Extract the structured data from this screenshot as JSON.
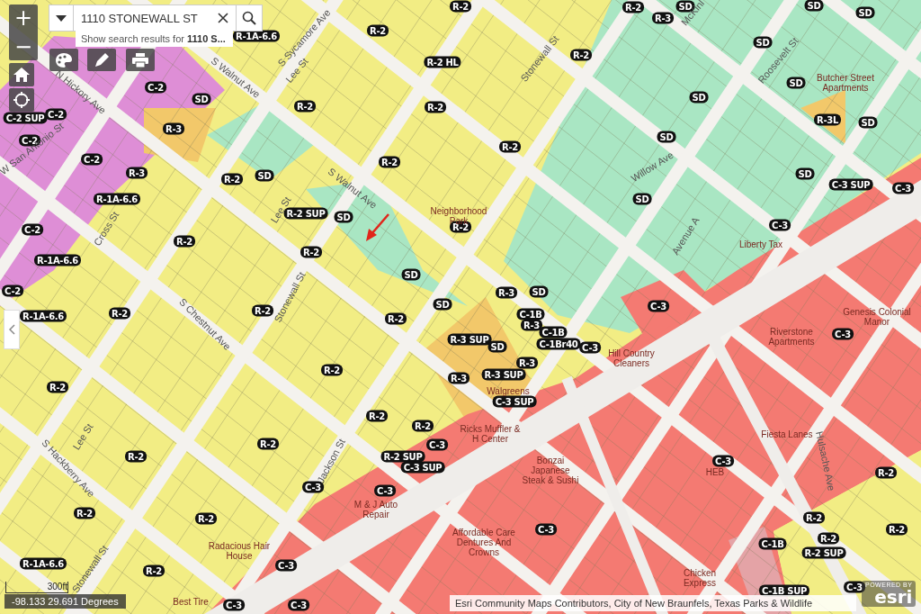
{
  "map_controls": {
    "zoom_in": "+",
    "zoom_out": "−"
  },
  "search": {
    "value": "1110 STONEWALL ST",
    "suggestion": "Show search results for **1110 S...**"
  },
  "zone_labels": [
    "R-1A-6.6",
    "R-2",
    "R-2",
    "R-3",
    "SD",
    "SD",
    "SD",
    "R-2",
    "R-2 HL",
    "R-2",
    "SD",
    "SD",
    "SD",
    "C-2",
    "C-2",
    "SD",
    "C-2 SUP",
    "R-2",
    "R-2",
    "R-3",
    "C-2",
    "R-3L",
    "SD",
    "C-2",
    "R-3",
    "R-2",
    "R-2",
    "SD",
    "R-2",
    "SD",
    "SD",
    "C-3 SUP",
    "C-3",
    "R-1A-6.6",
    "R-2 SUP",
    "SD",
    "R-2",
    "SD",
    "C-3",
    "C-2",
    "R-2",
    "R-2",
    "R-1A-6.6",
    "SD",
    "C-2",
    "R-3",
    "SD",
    "SD",
    "C-3",
    "R-2",
    "R-2",
    "R-2",
    "R-1A-6.6",
    "C-1B",
    "R-3",
    "C-1B",
    "C-1Br40",
    "C-3",
    "C-3",
    "R-3 SUP",
    "SD",
    "R-3",
    "R-3 SUP",
    "R-2",
    "R-3",
    "C-3 SUP",
    "R-2",
    "R-2",
    "R-2",
    "C-3",
    "R-2",
    "R-2",
    "R-2 SUP",
    "C-3 SUP",
    "C-3",
    "R-2",
    "C-3",
    "C-3",
    "R-2",
    "R-2",
    "R-2",
    "R-2",
    "C-3",
    "C-3",
    "R-1A-6.6",
    "R-2",
    "C-1B",
    "R-2",
    "R-2 SUP",
    "C-1B SUP",
    "C-3",
    "C-3",
    "C-3"
  ],
  "street_labels": [
    "S Walnut Ave",
    "S Sycamore Ave",
    "Lee St",
    "Stonewall St",
    "McKinl",
    "Roosevelt St",
    "N Hickory Ave",
    "W San Antonio St",
    "S Walnut Ave",
    "Willow Ave",
    "Lee St",
    "Avenue A",
    "Cross St",
    "Stonewall St",
    "S Chestnut Ave",
    "Lee St",
    "S Hackberry Ave",
    "Jackson St",
    "Hulsache Ave",
    "Stonewall St"
  ],
  "place_labels": [
    "Butcher Street Apartments",
    "Liberty Tax",
    "Neighborhood Park",
    "Genesis Colonial Manor",
    "Riverstone Apartments",
    "Hill Country Cleaners",
    "Walgreens",
    "Ricks Muffler & H Center",
    "Bonzai Japanese Steak & Sushi",
    "Fiesta Lanes",
    "HEB",
    "M & J Auto Repair",
    "Affordable Care Dentures And Crowns",
    "Chicken Express",
    "Radacious Hair House",
    "Best Tire"
  ],
  "scale": {
    "distance": "300ft"
  },
  "coordinates": "-98.133 29.691 Degrees",
  "attribution": "Esri Community Maps Contributors, City of New Braunfels, Texas Parks & Wildlife",
  "logo": {
    "caption": "POWERED BY",
    "name": "esri"
  }
}
